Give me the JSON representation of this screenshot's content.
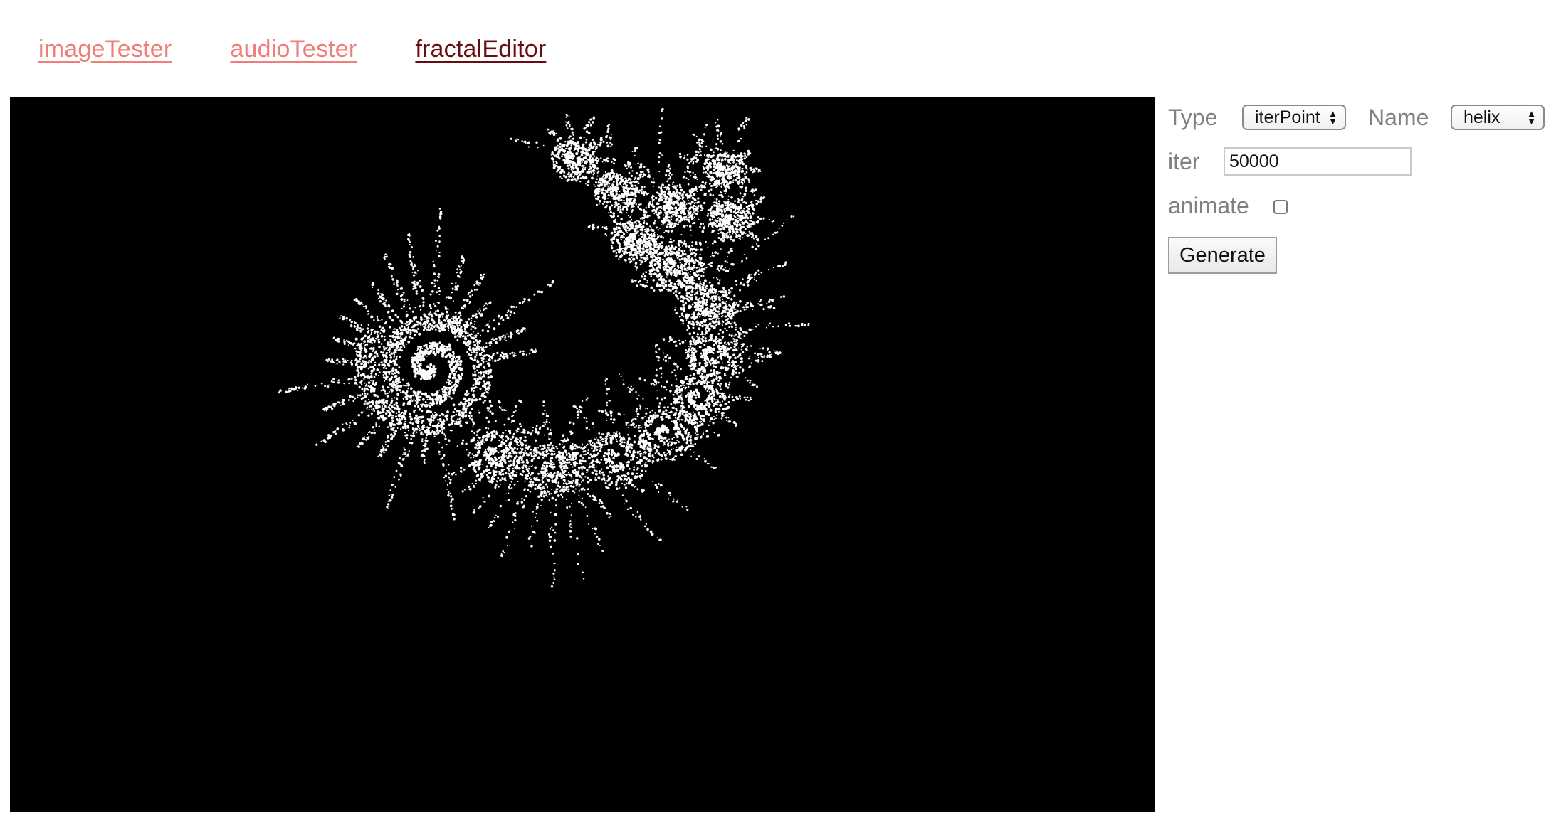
{
  "nav": {
    "links": [
      {
        "label": "imageTester",
        "active": false
      },
      {
        "label": "audioTester",
        "active": false
      },
      {
        "label": "fractalEditor",
        "active": true
      }
    ]
  },
  "canvas": {
    "background": "#000000",
    "point_color": "#ffffff"
  },
  "controls": {
    "type_label": "Type",
    "type_value": "iterPoint",
    "name_label": "Name",
    "name_value": "helix",
    "iter_label": "iter",
    "iter_value": "50000",
    "animate_label": "animate",
    "animate_checked": false,
    "generate_label": "Generate"
  },
  "colors": {
    "link_inactive": "#ef7d78",
    "link_active": "#6b0c0f",
    "label_gray": "#808080"
  }
}
